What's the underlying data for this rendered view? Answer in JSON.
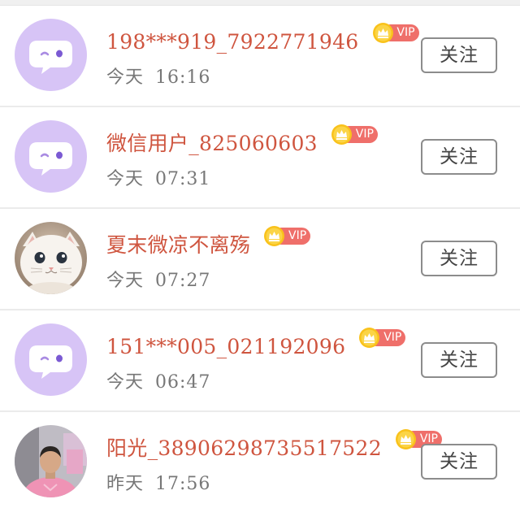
{
  "follow_list": {
    "items": [
      {
        "name": "198***919_7922771946",
        "vip_label": "VIP",
        "day": "今天",
        "time": "16:16",
        "follow_label": "关注",
        "avatar": "default-chat-avatar"
      },
      {
        "name": "微信用户_825060603",
        "vip_label": "VIP",
        "day": "今天",
        "time": "07:31",
        "follow_label": "关注",
        "avatar": "default-chat-avatar"
      },
      {
        "name": "夏末微凉不离殇",
        "vip_label": "VIP",
        "day": "今天",
        "time": "07:27",
        "follow_label": "关注",
        "avatar": "kitten-photo"
      },
      {
        "name": "151***005_021192096",
        "vip_label": "VIP",
        "day": "今天",
        "time": "06:47",
        "follow_label": "关注",
        "avatar": "default-chat-avatar"
      },
      {
        "name": "阳光_38906298735517522",
        "vip_label": "VIP",
        "day": "昨天",
        "time": "17:56",
        "follow_label": "关注",
        "avatar": "person-photo"
      }
    ]
  },
  "colors": {
    "name_text": "#cf553f",
    "vip_pill": "#ef6f6a",
    "default_avatar_bg": "#d7c4f6",
    "follow_border": "#8c8c8c"
  }
}
